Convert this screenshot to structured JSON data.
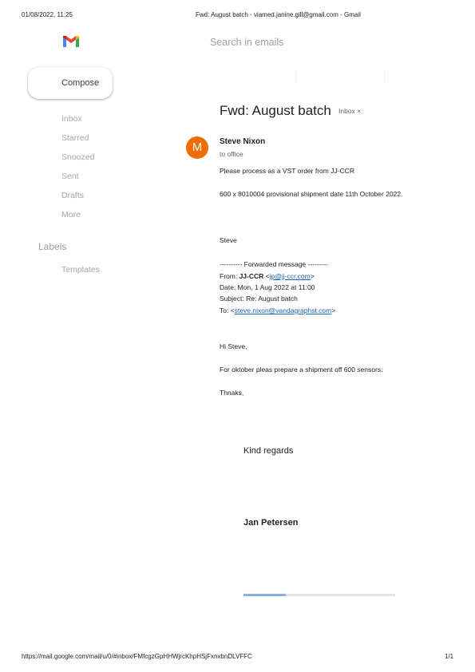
{
  "print_header": {
    "datetime": "01/08/2022, 11:25",
    "title": "Fwd: August batch - viamed.janine.gill@gmail.com - Gmail"
  },
  "print_footer": {
    "url": "https://mail.google.com/mail/u/0/#inbox/FMfcgzGpHHWjrcKhpHSjFxnxbnDLVFFC",
    "page": "1/1"
  },
  "logo": {
    "icon": "gmail-logo-icon",
    "colors": [
      "#4285f4",
      "#ea4335",
      "#fbbc04",
      "#34a853"
    ]
  },
  "search": {
    "placeholder": "Search in emails"
  },
  "sidebar": {
    "compose_label": "Compose",
    "items": [
      "Inbox",
      "Starred",
      "Snoozed",
      "Sent",
      "Drafts",
      "More"
    ],
    "labels_heading": "Labels",
    "labels": [
      "Templates"
    ]
  },
  "email": {
    "subject": "Fwd: August batch",
    "label_chip": "Inbox ×",
    "avatar_letter": "M",
    "avatar_color": "#ef6c00",
    "sender": "Steve Nixon",
    "to": "to office",
    "body_intro": "Please process as a VST order from JJ-CCR",
    "body_detail": "600 x 8010004 provisional shipment date 11th October 2022.",
    "body_sign": "Steve",
    "fwd_header": "---------- Forwarded message ---------",
    "fwd_from_prefix": "From: ",
    "fwd_from_name": "JJ-CCR",
    "fwd_from_open": " <",
    "fwd_from_email": "jp@jj-ccr.com",
    "fwd_from_close": ">",
    "fwd_date": "Date: Mon, 1 Aug 2022 at 11:00",
    "fwd_subject": "Subject: Re: August batch",
    "fwd_to_prefix": "To: <",
    "fwd_to_email": "steve.nixon@vandagraphst.com",
    "fwd_to_close": ">",
    "greeting": "Hi Steve,",
    "request": "For oktober pleas prepare a shipment off 600 sensors.",
    "thanks": "Thnaks,",
    "regards": "Kind regards",
    "signature_name": "Jan Petersen"
  }
}
